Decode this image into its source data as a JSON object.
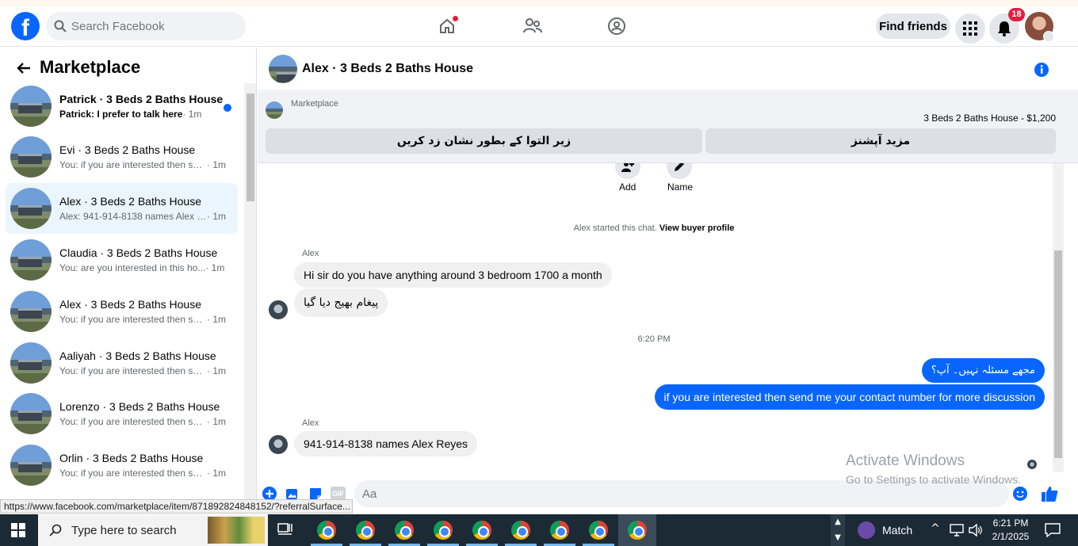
{
  "search": {
    "placeholder": "Search Facebook"
  },
  "topbar": {
    "find_friends": "Find friends",
    "notif_count": "18"
  },
  "sidebar": {
    "title": "Marketplace",
    "conversations": [
      {
        "name": "Patrick · 3 Beds 2 Baths House",
        "preview": "Patrick: I prefer to talk here",
        "time": "· 1m",
        "unread": true
      },
      {
        "name": "Evi · 3 Beds 2 Baths House",
        "preview": "You: if you are interested then sen...",
        "time": "· 1m"
      },
      {
        "name": "Alex · 3 Beds 2 Baths House",
        "preview": "Alex: 941-914-8138 names Alex R...",
        "time": "· 1m",
        "active": true
      },
      {
        "name": "Claudia · 3 Beds 2 Baths House",
        "preview": "You: are you interested in this ho...",
        "time": "· 1m"
      },
      {
        "name": "Alex · 3 Beds 2 Baths House",
        "preview": "You: if you are interested then sen...",
        "time": "· 1m"
      },
      {
        "name": "Aaliyah · 3 Beds 2 Baths House",
        "preview": "You: if you are interested then sen...",
        "time": "· 1m"
      },
      {
        "name": "Lorenzo · 3 Beds 2 Baths House",
        "preview": "You: if you are interested then sen...",
        "time": "· 1m"
      },
      {
        "name": "Orlin · 3 Beds 2 Baths House",
        "preview": "You: if you are interested then sen...",
        "time": "· 1m"
      }
    ]
  },
  "chat": {
    "title": "Alex · 3 Beds 2 Baths House",
    "listing_source": "Marketplace",
    "listing_title": "3 Beds 2 Baths House - $1,200",
    "btn_mark_pending": "زیر التوا کے بطور نشان زد کریں",
    "btn_more_options": "مزید آپشنز",
    "action_add": "Add",
    "action_name": "Name",
    "started_text": "Alex started this chat.",
    "view_profile": "View buyer profile",
    "sender_1": "Alex",
    "msg_1": "Hi sir do you have anything around 3 bedroom 1700 a month",
    "msg_2": "پیغام بھیج دیا گیا",
    "timestamp": "6:20 PM",
    "msg_3": "مجھے مسئلہ نہیں۔ آپ؟",
    "msg_4": "if you are interested then send me your contact number for  more discussion",
    "sender_2": "Alex",
    "msg_5": "941-914-8138 names Alex Reyes",
    "composer_placeholder": "Aa"
  },
  "status_url": "https://www.facebook.com/marketplace/item/871892824848152/?referralSurface...",
  "watermark": {
    "title": "Activate Windows",
    "subtitle": "Go to Settings to activate Windows."
  },
  "taskbar": {
    "search": "Type here to search",
    "weather": "Match",
    "time": "6:21 PM",
    "date": "2/1/2025"
  },
  "colors": {
    "brand": "#0866ff",
    "badge": "#e41e3f",
    "active_row": "#ebf5ff"
  }
}
